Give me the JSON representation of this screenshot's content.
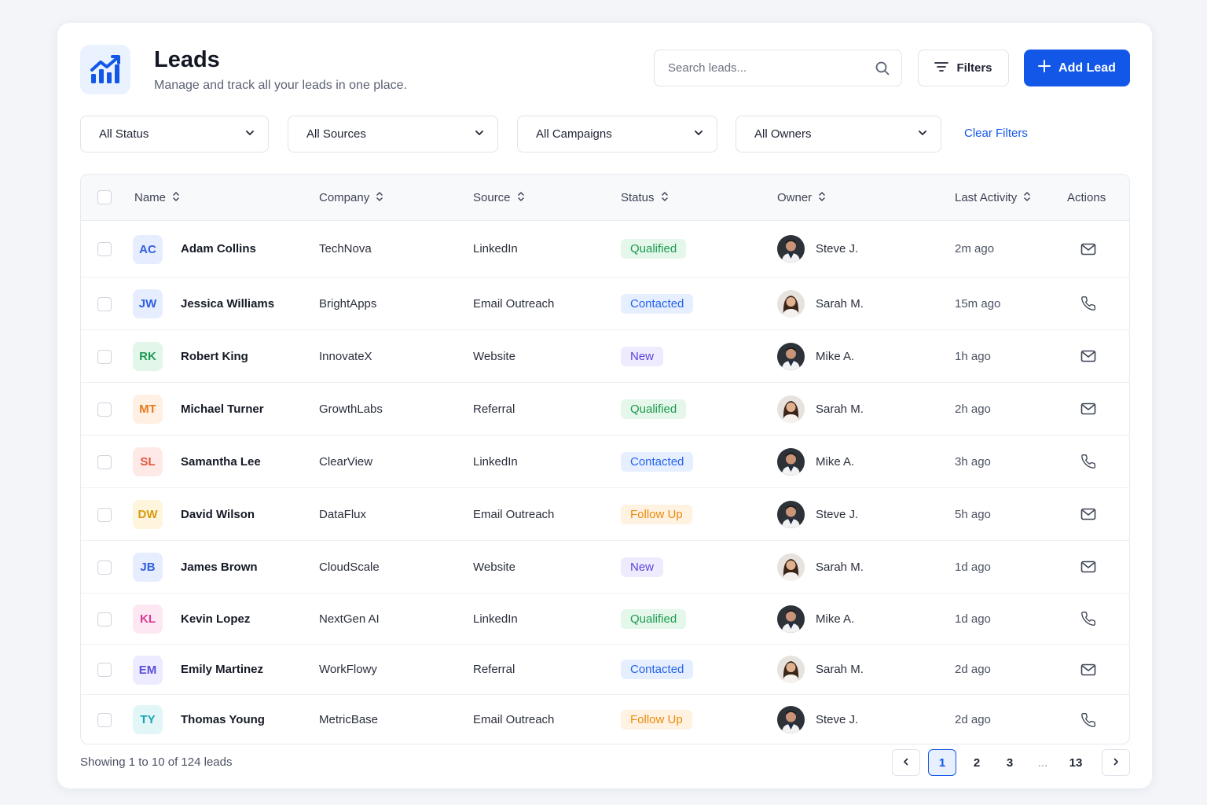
{
  "header": {
    "title": "Leads",
    "subtitle": "Manage and track all your leads in one place.",
    "icon": "chart-growth-icon"
  },
  "search": {
    "placeholder": "Search leads..."
  },
  "toolbar": {
    "filters_label": "Filters",
    "add_label": "Add Lead"
  },
  "filters": {
    "status": "All Status",
    "sources": "All Sources",
    "campaigns": "All Campaigns",
    "owners": "All Owners",
    "clear": "Clear Filters"
  },
  "table": {
    "columns": [
      "Name",
      "Company",
      "Source",
      "Status",
      "Owner",
      "Last Activity",
      "Actions"
    ],
    "rows": [
      {
        "initials": "AC",
        "name": "Adam Collins",
        "company": "TechNova",
        "source": "LinkedIn",
        "status": "Qualified",
        "owner": "Steve J.",
        "owner_gender": "m",
        "activity": "2m ago",
        "action": "mail-icon"
      },
      {
        "initials": "JW",
        "name": "Jessica Williams",
        "company": "BrightApps",
        "source": "Email Outreach",
        "status": "Contacted",
        "owner": "Sarah M.",
        "owner_gender": "f",
        "activity": "15m ago",
        "action": "phone-icon"
      },
      {
        "initials": "RK",
        "name": "Robert King",
        "company": "InnovateX",
        "source": "Website",
        "status": "New",
        "owner": "Mike A.",
        "owner_gender": "m",
        "activity": "1h ago",
        "action": "mail-icon"
      },
      {
        "initials": "MT",
        "name": "Michael Turner",
        "company": "GrowthLabs",
        "source": "Referral",
        "status": "Qualified",
        "owner": "Sarah M.",
        "owner_gender": "f",
        "activity": "2h ago",
        "action": "mail-icon"
      },
      {
        "initials": "SL",
        "name": "Samantha Lee",
        "company": "ClearView",
        "source": "LinkedIn",
        "status": "Contacted",
        "owner": "Mike A.",
        "owner_gender": "m",
        "activity": "3h ago",
        "action": "phone-icon"
      },
      {
        "initials": "DW",
        "name": "David Wilson",
        "company": "DataFlux",
        "source": "Email Outreach",
        "status": "Follow Up",
        "owner": "Steve J.",
        "owner_gender": "m",
        "activity": "5h ago",
        "action": "mail-icon"
      },
      {
        "initials": "JB",
        "name": "James Brown",
        "company": "CloudScale",
        "source": "Website",
        "status": "New",
        "owner": "Sarah M.",
        "owner_gender": "f",
        "activity": "1d ago",
        "action": "mail-icon"
      },
      {
        "initials": "KL",
        "name": "Kevin Lopez",
        "company": "NextGen AI",
        "source": "LinkedIn",
        "status": "Qualified",
        "owner": "Mike A.",
        "owner_gender": "m",
        "activity": "1d ago",
        "action": "phone-icon"
      },
      {
        "initials": "EM",
        "name": "Emily Martinez",
        "company": "WorkFlowy",
        "source": "Referral",
        "status": "Contacted",
        "owner": "Sarah M.",
        "owner_gender": "f",
        "activity": "2d ago",
        "action": "mail-icon"
      },
      {
        "initials": "TY",
        "name": "Thomas Young",
        "company": "MetricBase",
        "source": "Email Outreach",
        "status": "Follow Up",
        "owner": "Steve J.",
        "owner_gender": "m",
        "activity": "2d ago",
        "action": "phone-icon"
      }
    ]
  },
  "avatar_colors": {
    "AC": {
      "bg": "#e6edff",
      "fg": "#2f5fe0"
    },
    "JW": {
      "bg": "#e6edff",
      "fg": "#2f5fe0"
    },
    "RK": {
      "bg": "#e3f6ea",
      "fg": "#1f9a55"
    },
    "MT": {
      "bg": "#fff0e3",
      "fg": "#e67a1c"
    },
    "SL": {
      "bg": "#ffe9e6",
      "fg": "#e0553f"
    },
    "DW": {
      "bg": "#fff5dc",
      "fg": "#d89a10"
    },
    "JB": {
      "bg": "#e6edff",
      "fg": "#2f5fe0"
    },
    "KL": {
      "bg": "#fde7f3",
      "fg": "#d63a92"
    },
    "EM": {
      "bg": "#ecebff",
      "fg": "#5a4fd8"
    },
    "TY": {
      "bg": "#e2f6f8",
      "fg": "#1aa2b5"
    }
  },
  "status_colors": {
    "Qualified": {
      "bg": "#e4f7ea",
      "fg": "#1b9a4e"
    },
    "Contacted": {
      "bg": "#e6efff",
      "fg": "#2563eb"
    },
    "New": {
      "bg": "#eeebff",
      "fg": "#5b43d6"
    },
    "Follow Up": {
      "bg": "#fff2e0",
      "fg": "#ea8a12"
    }
  },
  "footer": {
    "showing": "Showing 1 to 10 of 124 leads",
    "pages": [
      "1",
      "2",
      "3",
      "...",
      "13"
    ],
    "current_page": "1"
  }
}
